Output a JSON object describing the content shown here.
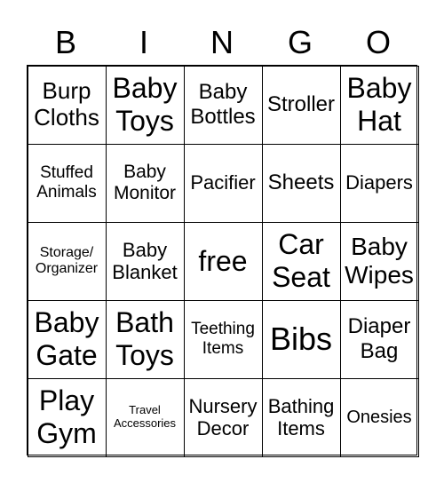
{
  "header": [
    "B",
    "I",
    "N",
    "G",
    "O"
  ],
  "cells": [
    "Burp Cloths",
    "Baby Toys",
    "Baby Bottles",
    "Stroller",
    "Baby Hat",
    "Stuffed Animals",
    "Baby Monitor",
    "Pacifier",
    "Sheets",
    "Diapers",
    "Storage/ Organizer",
    "Baby Blanket",
    "free",
    "Car Seat",
    "Baby Wipes",
    "Baby Gate",
    "Bath Toys",
    "Teething Items",
    "Bibs",
    "Diaper Bag",
    "Play Gym",
    "Travel Accessories",
    "Nursery Decor",
    "Bathing Items",
    "Onesies"
  ]
}
